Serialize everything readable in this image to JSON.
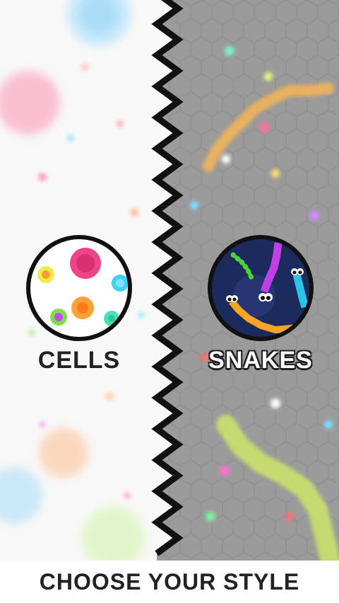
{
  "modes": {
    "cells": {
      "label": "CELLS",
      "icon": "cells-icon"
    },
    "snakes": {
      "label": "SNAKES",
      "icon": "snakes-icon"
    }
  },
  "footer": {
    "title": "CHOOSE YOUR STYLE"
  },
  "colors": {
    "cells_background": "#f7f7f7",
    "snakes_background": "#9a9a9a",
    "label_dark": "#222222",
    "snake_orange": "#f5a623",
    "snake_purple": "#c040e8",
    "snake_cyan": "#29c4e8",
    "snake_green": "#4cd23c"
  }
}
